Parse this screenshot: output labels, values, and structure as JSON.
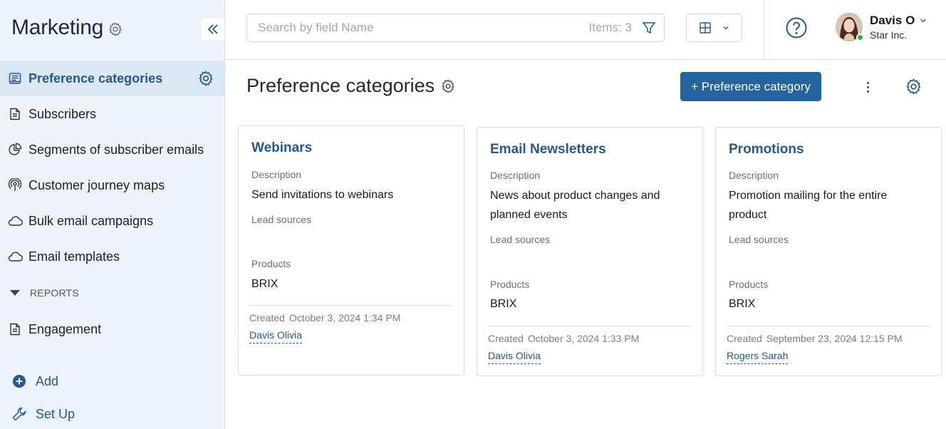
{
  "app": {
    "title": "Marketing"
  },
  "sidebar": {
    "items": [
      {
        "label": "Preference categories"
      },
      {
        "label": "Subscribers"
      },
      {
        "label": "Segments of subscriber emails"
      },
      {
        "label": "Customer journey maps"
      },
      {
        "label": "Bulk email campaigns"
      },
      {
        "label": "Email templates"
      }
    ],
    "reports_label": "REPORTS",
    "report_items": [
      {
        "label": "Engagement"
      }
    ],
    "add_label": "Add",
    "setup_label": "Set Up"
  },
  "topbar": {
    "search_placeholder": "Search by field Name",
    "items_count": "Items: 3",
    "user": {
      "name": "Davis O",
      "company": "Star Inc."
    }
  },
  "page": {
    "title": "Preference categories",
    "add_button_label": "+ Preference category"
  },
  "cards": [
    {
      "title": "Webinars",
      "description_label": "Description",
      "description": "Send invitations to webinars",
      "lead_sources_label": "Lead sources",
      "products_label": "Products",
      "products": "BRIX",
      "created_label": "Created",
      "created_date": "October 3, 2024 1:34 PM",
      "author": "Davis Olivia"
    },
    {
      "title": "Email Newsletters",
      "description_label": "Description",
      "description": "News about product changes and planned events",
      "lead_sources_label": "Lead sources",
      "products_label": "Products",
      "products": "BRIX",
      "created_label": "Created",
      "created_date": "October 3, 2024 1:33 PM",
      "author": "Davis Olivia"
    },
    {
      "title": "Promotions",
      "description_label": "Description",
      "description": "Promotion mailing for the entire product",
      "lead_sources_label": "Lead sources",
      "products_label": "Products",
      "products": "BRIX",
      "created_label": "Created",
      "created_date": "September 23, 2024 12:15 PM",
      "author": "Rogers Sarah"
    }
  ],
  "colors": {
    "accent": "#25598f",
    "primary_button": "#23649e",
    "sidebar_bg": "#eef3f9",
    "sidebar_active_bg": "#dbe7f3",
    "online": "#32b04b"
  }
}
